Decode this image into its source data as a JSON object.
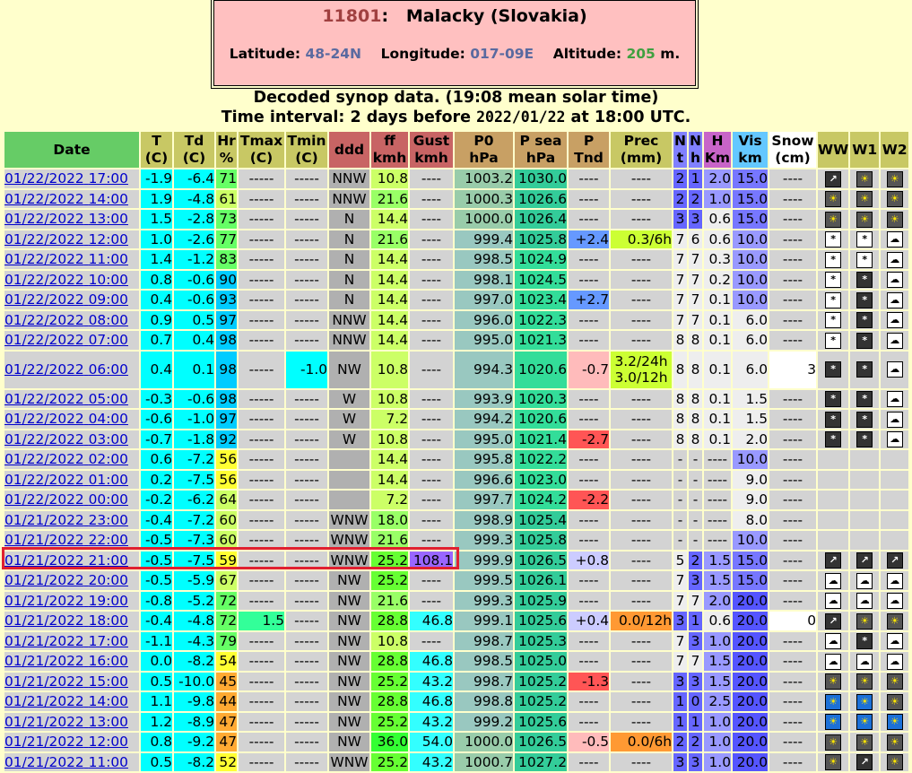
{
  "station": {
    "id": "11801",
    "name": "Malacky (Slovakia)",
    "lat_label": "Latitude:",
    "lat": "48-24N",
    "lon_label": "Longitude:",
    "lon": "017-09E",
    "alt_label": "Altitude:",
    "alt": "205",
    "alt_unit": "m."
  },
  "heading": {
    "line1": "Decoded synop data. (19:08 mean solar time)",
    "line2_pre": "Time interval: 2 days before ",
    "line2_date": "2022/01/22",
    "line2_post": " at 18:00 UTC."
  },
  "columns": [
    {
      "l1": "Date",
      "l2": ""
    },
    {
      "l1": "T",
      "l2": "(C)"
    },
    {
      "l1": "Td",
      "l2": "(C)"
    },
    {
      "l1": "Hr",
      "l2": "%"
    },
    {
      "l1": "Tmax",
      "l2": "(C)"
    },
    {
      "l1": "Tmin",
      "l2": "(C)"
    },
    {
      "l1": "ddd",
      "l2": ""
    },
    {
      "l1": "ff",
      "l2": "kmh"
    },
    {
      "l1": "Gust",
      "l2": "kmh"
    },
    {
      "l1": "P0",
      "l2": "hPa"
    },
    {
      "l1": "P sea",
      "l2": "hPa"
    },
    {
      "l1": "P",
      "l2": "Tnd"
    },
    {
      "l1": "Prec",
      "l2": "(mm)"
    },
    {
      "l1": "N",
      "l2": "t"
    },
    {
      "l1": "N",
      "l2": "h"
    },
    {
      "l1": "H",
      "l2": "Km"
    },
    {
      "l1": "Vis",
      "l2": "km"
    },
    {
      "l1": "Snow",
      "l2": "(cm)"
    },
    {
      "l1": "WW",
      "l2": ""
    },
    {
      "l1": "W1",
      "l2": ""
    },
    {
      "l1": "W2",
      "l2": ""
    }
  ],
  "rows": [
    {
      "date": "01/22/2022",
      "time": "17:00",
      "t": "-1.9",
      "td": "-6.4",
      "hr": "71",
      "tmax": "-----",
      "tmin": "-----",
      "ddd": "NNW",
      "ff": "10.8",
      "gust": "----",
      "p0": "1003.2",
      "psea": "1030.0",
      "ptnd": "----",
      "prec": "----",
      "nt": "2",
      "nh": "1",
      "h": "2.0",
      "vis": "15.0",
      "snow": "----",
      "ww": "wind-icon",
      "w1": "sun-cloud-icon",
      "w2": "sun-cloud-icon"
    },
    {
      "date": "01/22/2022",
      "time": "14:00",
      "t": "1.9",
      "td": "-4.8",
      "hr": "61",
      "tmax": "-----",
      "tmin": "-----",
      "ddd": "NNW",
      "ff": "21.6",
      "gust": "----",
      "p0": "1000.3",
      "psea": "1026.6",
      "ptnd": "----",
      "prec": "----",
      "nt": "2",
      "nh": "2",
      "h": "1.0",
      "vis": "15.0",
      "snow": "----",
      "ww": "sun-cloud-icon",
      "w1": "sun-cloud-icon",
      "w2": "sun-cloud-icon"
    },
    {
      "date": "01/22/2022",
      "time": "13:00",
      "t": "1.5",
      "td": "-2.8",
      "hr": "73",
      "tmax": "-----",
      "tmin": "-----",
      "ddd": "N",
      "ff": "14.4",
      "gust": "----",
      "p0": "1000.0",
      "psea": "1026.4",
      "ptnd": "----",
      "prec": "----",
      "nt": "3",
      "nh": "3",
      "h": "0.6",
      "vis": "15.0",
      "snow": "----",
      "ww": "sun-cloud-icon",
      "w1": "sun-cloud-icon",
      "w2": "sun-cloud-icon"
    },
    {
      "date": "01/22/2022",
      "time": "12:00",
      "t": "1.0",
      "td": "-2.6",
      "hr": "77",
      "tmax": "-----",
      "tmin": "-----",
      "ddd": "N",
      "ff": "21.6",
      "gust": "----",
      "p0": "999.4",
      "psea": "1025.8",
      "ptnd": "+2.4",
      "prec": "0.3/6h",
      "nt": "7",
      "nh": "6",
      "h": "0.6",
      "vis": "10.0",
      "snow": "----",
      "ww": "snow-icon",
      "w1": "snow-icon",
      "w2": "cloud-icon"
    },
    {
      "date": "01/22/2022",
      "time": "11:00",
      "t": "1.4",
      "td": "-1.2",
      "hr": "83",
      "tmax": "-----",
      "tmin": "-----",
      "ddd": "N",
      "ff": "14.4",
      "gust": "----",
      "p0": "998.5",
      "psea": "1024.9",
      "ptnd": "----",
      "prec": "----",
      "nt": "7",
      "nh": "7",
      "h": "0.3",
      "vis": "10.0",
      "snow": "----",
      "ww": "snow-icon",
      "w1": "snow-icon",
      "w2": "cloud-icon"
    },
    {
      "date": "01/22/2022",
      "time": "10:00",
      "t": "0.8",
      "td": "-0.6",
      "hr": "90",
      "tmax": "-----",
      "tmin": "-----",
      "ddd": "N",
      "ff": "14.4",
      "gust": "----",
      "p0": "998.1",
      "psea": "1024.5",
      "ptnd": "----",
      "prec": "----",
      "nt": "7",
      "nh": "7",
      "h": "0.2",
      "vis": "10.0",
      "snow": "----",
      "ww": "snow-icon",
      "w1": "snow-dark-icon",
      "w2": "cloud-icon"
    },
    {
      "date": "01/22/2022",
      "time": "09:00",
      "t": "0.4",
      "td": "-0.6",
      "hr": "93",
      "tmax": "-----",
      "tmin": "-----",
      "ddd": "N",
      "ff": "14.4",
      "gust": "----",
      "p0": "997.0",
      "psea": "1023.4",
      "ptnd": "+2.7",
      "prec": "----",
      "nt": "7",
      "nh": "7",
      "h": "0.1",
      "vis": "10.0",
      "snow": "----",
      "ww": "snow-icon",
      "w1": "snow-dark-icon",
      "w2": "cloud-icon"
    },
    {
      "date": "01/22/2022",
      "time": "08:00",
      "t": "0.9",
      "td": "0.5",
      "hr": "97",
      "tmax": "-----",
      "tmin": "-----",
      "ddd": "NNW",
      "ff": "14.4",
      "gust": "----",
      "p0": "996.0",
      "psea": "1022.3",
      "ptnd": "----",
      "prec": "----",
      "nt": "7",
      "nh": "7",
      "h": "0.1",
      "vis": "6.0",
      "snow": "----",
      "ww": "snow-icon",
      "w1": "snow-dark-icon",
      "w2": "cloud-icon"
    },
    {
      "date": "01/22/2022",
      "time": "07:00",
      "t": "0.7",
      "td": "0.4",
      "hr": "98",
      "tmax": "-----",
      "tmin": "-----",
      "ddd": "NNW",
      "ff": "14.4",
      "gust": "----",
      "p0": "995.0",
      "psea": "1021.3",
      "ptnd": "----",
      "prec": "----",
      "nt": "8",
      "nh": "8",
      "h": "0.1",
      "vis": "6.0",
      "snow": "----",
      "ww": "snow-icon",
      "w1": "snow-dark-icon",
      "w2": "cloud-icon"
    },
    {
      "date": "01/22/2022",
      "time": "06:00",
      "t": "0.4",
      "td": "0.1",
      "hr": "98",
      "tmax": "-----",
      "tmin": "-1.0",
      "ddd": "NW",
      "ff": "10.8",
      "gust": "----",
      "p0": "994.3",
      "psea": "1020.6",
      "ptnd": "-0.7",
      "prec": "3.2/24h",
      "prec2": "3.0/12h",
      "nt": "8",
      "nh": "8",
      "h": "0.1",
      "vis": "6.0",
      "snow": "3",
      "ww": "snow-dark-icon",
      "w1": "snow-dark-icon",
      "w2": "cloud-icon"
    },
    {
      "date": "01/22/2022",
      "time": "05:00",
      "t": "-0.3",
      "td": "-0.6",
      "hr": "98",
      "tmax": "-----",
      "tmin": "-----",
      "ddd": "W",
      "ff": "10.8",
      "gust": "----",
      "p0": "993.9",
      "psea": "1020.3",
      "ptnd": "----",
      "prec": "----",
      "nt": "8",
      "nh": "8",
      "h": "0.1",
      "vis": "1.5",
      "snow": "----",
      "ww": "snow-dark-icon",
      "w1": "snow-dark-icon",
      "w2": "cloud-icon"
    },
    {
      "date": "01/22/2022",
      "time": "04:00",
      "t": "-0.6",
      "td": "-1.0",
      "hr": "97",
      "tmax": "-----",
      "tmin": "-----",
      "ddd": "W",
      "ff": "7.2",
      "gust": "----",
      "p0": "994.2",
      "psea": "1020.6",
      "ptnd": "----",
      "prec": "----",
      "nt": "8",
      "nh": "8",
      "h": "0.1",
      "vis": "1.5",
      "snow": "----",
      "ww": "snow-dark-icon",
      "w1": "snow-dark-icon",
      "w2": "cloud-icon"
    },
    {
      "date": "01/22/2022",
      "time": "03:00",
      "t": "-0.7",
      "td": "-1.8",
      "hr": "92",
      "tmax": "-----",
      "tmin": "-----",
      "ddd": "W",
      "ff": "10.8",
      "gust": "----",
      "p0": "995.0",
      "psea": "1021.4",
      "ptnd": "-2.7",
      "prec": "----",
      "nt": "8",
      "nh": "8",
      "h": "0.1",
      "vis": "2.0",
      "snow": "----",
      "ww": "snow-dark-icon",
      "w1": "snow-dark-icon",
      "w2": "cloud-icon"
    },
    {
      "date": "01/22/2022",
      "time": "02:00",
      "t": "0.6",
      "td": "-7.2",
      "hr": "56",
      "tmax": "-----",
      "tmin": "-----",
      "ddd": "",
      "ff": "14.4",
      "gust": "----",
      "p0": "995.8",
      "psea": "1022.2",
      "ptnd": "----",
      "prec": "----",
      "nt": "-",
      "nh": "-",
      "h": "----",
      "vis": "10.0",
      "snow": "----",
      "ww": "",
      "w1": "",
      "w2": ""
    },
    {
      "date": "01/22/2022",
      "time": "01:00",
      "t": "0.2",
      "td": "-7.5",
      "hr": "56",
      "tmax": "-----",
      "tmin": "-----",
      "ddd": "",
      "ff": "14.4",
      "gust": "----",
      "p0": "996.6",
      "psea": "1023.0",
      "ptnd": "----",
      "prec": "----",
      "nt": "-",
      "nh": "-",
      "h": "----",
      "vis": "9.0",
      "snow": "----",
      "ww": "",
      "w1": "",
      "w2": ""
    },
    {
      "date": "01/22/2022",
      "time": "00:00",
      "t": "-0.2",
      "td": "-6.2",
      "hr": "64",
      "tmax": "-----",
      "tmin": "-----",
      "ddd": "",
      "ff": "7.2",
      "gust": "----",
      "p0": "997.7",
      "psea": "1024.2",
      "ptnd": "-2.2",
      "prec": "----",
      "nt": "-",
      "nh": "-",
      "h": "----",
      "vis": "9.0",
      "snow": "----",
      "ww": "",
      "w1": "",
      "w2": ""
    },
    {
      "date": "01/21/2022",
      "time": "23:00",
      "t": "-0.4",
      "td": "-7.2",
      "hr": "60",
      "tmax": "-----",
      "tmin": "-----",
      "ddd": "WNW",
      "ff": "18.0",
      "gust": "----",
      "p0": "998.9",
      "psea": "1025.4",
      "ptnd": "----",
      "prec": "----",
      "nt": "-",
      "nh": "-",
      "h": "----",
      "vis": "8.0",
      "snow": "----",
      "ww": "",
      "w1": "",
      "w2": ""
    },
    {
      "date": "01/21/2022",
      "time": "22:00",
      "t": "-0.5",
      "td": "-7.3",
      "hr": "60",
      "tmax": "-----",
      "tmin": "-----",
      "ddd": "WNW",
      "ff": "21.6",
      "gust": "----",
      "p0": "999.3",
      "psea": "1025.8",
      "ptnd": "----",
      "prec": "----",
      "nt": "-",
      "nh": "-",
      "h": "----",
      "vis": "10.0",
      "snow": "----",
      "ww": "",
      "w1": "",
      "w2": ""
    },
    {
      "date": "01/21/2022",
      "time": "21:00",
      "t": "-0.5",
      "td": "-7.5",
      "hr": "59",
      "tmax": "-----",
      "tmin": "-----",
      "ddd": "WNW",
      "ff": "25.2",
      "gust": "108.1",
      "p0": "999.9",
      "psea": "1026.5",
      "ptnd": "+0.8",
      "prec": "----",
      "nt": "5",
      "nh": "2",
      "h": "1.5",
      "vis": "15.0",
      "snow": "----",
      "ww": "wind-icon",
      "w1": "wind-icon",
      "w2": "wind-icon"
    },
    {
      "date": "01/21/2022",
      "time": "20:00",
      "t": "-0.5",
      "td": "-5.9",
      "hr": "67",
      "tmax": "-----",
      "tmin": "-----",
      "ddd": "NW",
      "ff": "25.2",
      "gust": "----",
      "p0": "999.5",
      "psea": "1026.1",
      "ptnd": "----",
      "prec": "----",
      "nt": "7",
      "nh": "3",
      "h": "1.5",
      "vis": "15.0",
      "snow": "----",
      "ww": "cloud-icon",
      "w1": "cloud-icon",
      "w2": "cloud-icon"
    },
    {
      "date": "01/21/2022",
      "time": "19:00",
      "t": "-0.8",
      "td": "-5.2",
      "hr": "72",
      "tmax": "-----",
      "tmin": "-----",
      "ddd": "NW",
      "ff": "21.6",
      "gust": "----",
      "p0": "999.3",
      "psea": "1025.9",
      "ptnd": "----",
      "prec": "----",
      "nt": "7",
      "nh": "7",
      "h": "2.0",
      "vis": "20.0",
      "snow": "----",
      "ww": "cloud-icon",
      "w1": "cloud-icon",
      "w2": "cloud-icon"
    },
    {
      "date": "01/21/2022",
      "time": "18:00",
      "t": "-0.4",
      "td": "-4.8",
      "hr": "72",
      "tmax": "1.5",
      "tmin": "-----",
      "ddd": "NW",
      "ff": "28.8",
      "gust": "46.8",
      "p0": "999.1",
      "psea": "1025.6",
      "ptnd": "+0.4",
      "prec": "0.0/12h",
      "nt": "3",
      "nh": "1",
      "h": "0.6",
      "vis": "20.0",
      "snow": "0",
      "ww": "wind-icon",
      "w1": "sun-cloud-icon",
      "w2": "sun-cloud-icon"
    },
    {
      "date": "01/21/2022",
      "time": "17:00",
      "t": "-1.1",
      "td": "-4.3",
      "hr": "79",
      "tmax": "-----",
      "tmin": "-----",
      "ddd": "NW",
      "ff": "10.8",
      "gust": "----",
      "p0": "998.7",
      "psea": "1025.3",
      "ptnd": "----",
      "prec": "----",
      "nt": "7",
      "nh": "3",
      "h": "1.0",
      "vis": "20.0",
      "snow": "----",
      "ww": "cloud-icon",
      "w1": "snow-dark-icon",
      "w2": "cloud-icon"
    },
    {
      "date": "01/21/2022",
      "time": "16:00",
      "t": "0.0",
      "td": "-8.2",
      "hr": "54",
      "tmax": "-----",
      "tmin": "-----",
      "ddd": "NW",
      "ff": "28.8",
      "gust": "46.8",
      "p0": "998.5",
      "psea": "1025.0",
      "ptnd": "----",
      "prec": "----",
      "nt": "7",
      "nh": "7",
      "h": "1.5",
      "vis": "20.0",
      "snow": "----",
      "ww": "cloud-icon",
      "w1": "cloud-icon",
      "w2": "cloud-icon"
    },
    {
      "date": "01/21/2022",
      "time": "15:00",
      "t": "0.5",
      "td": "-10.0",
      "hr": "45",
      "tmax": "-----",
      "tmin": "-----",
      "ddd": "NW",
      "ff": "25.2",
      "gust": "43.2",
      "p0": "998.7",
      "psea": "1025.2",
      "ptnd": "-1.3",
      "prec": "----",
      "nt": "3",
      "nh": "3",
      "h": "1.5",
      "vis": "20.0",
      "snow": "----",
      "ww": "sun-cloud-icon",
      "w1": "sun-cloud-icon",
      "w2": "sun-cloud-icon"
    },
    {
      "date": "01/21/2022",
      "time": "14:00",
      "t": "1.1",
      "td": "-9.8",
      "hr": "44",
      "tmax": "-----",
      "tmin": "-----",
      "ddd": "NW",
      "ff": "28.8",
      "gust": "46.8",
      "p0": "998.8",
      "psea": "1025.2",
      "ptnd": "----",
      "prec": "----",
      "nt": "1",
      "nh": "0",
      "h": "2.5",
      "vis": "20.0",
      "snow": "----",
      "ww": "sun-icon",
      "w1": "sun-icon",
      "w2": "sun-cloud-icon"
    },
    {
      "date": "01/21/2022",
      "time": "13:00",
      "t": "1.2",
      "td": "-8.9",
      "hr": "47",
      "tmax": "-----",
      "tmin": "-----",
      "ddd": "NW",
      "ff": "25.2",
      "gust": "43.2",
      "p0": "999.2",
      "psea": "1025.6",
      "ptnd": "----",
      "prec": "----",
      "nt": "1",
      "nh": "1",
      "h": "1.0",
      "vis": "20.0",
      "snow": "----",
      "ww": "sun-icon",
      "w1": "sun-icon",
      "w2": "sun-icon"
    },
    {
      "date": "01/21/2022",
      "time": "12:00",
      "t": "0.8",
      "td": "-9.2",
      "hr": "47",
      "tmax": "-----",
      "tmin": "-----",
      "ddd": "NW",
      "ff": "36.0",
      "gust": "54.0",
      "p0": "1000.0",
      "psea": "1026.5",
      "ptnd": "-0.5",
      "prec": "0.0/6h",
      "nt": "2",
      "nh": "2",
      "h": "1.0",
      "vis": "20.0",
      "snow": "----",
      "ww": "sun-cloud-icon",
      "w1": "sun-cloud-icon",
      "w2": "sun-cloud-icon"
    },
    {
      "date": "01/21/2022",
      "time": "11:00",
      "t": "0.5",
      "td": "-8.2",
      "hr": "52",
      "tmax": "-----",
      "tmin": "-----",
      "ddd": "WNW",
      "ff": "25.2",
      "gust": "43.2",
      "p0": "1000.7",
      "psea": "1027.2",
      "ptnd": "----",
      "prec": "----",
      "nt": "3",
      "nh": "3",
      "h": "1.0",
      "vis": "20.0",
      "snow": "----",
      "ww": "sun-cloud-icon",
      "w1": "wind-icon",
      "w2": "sun-cloud-icon"
    }
  ]
}
